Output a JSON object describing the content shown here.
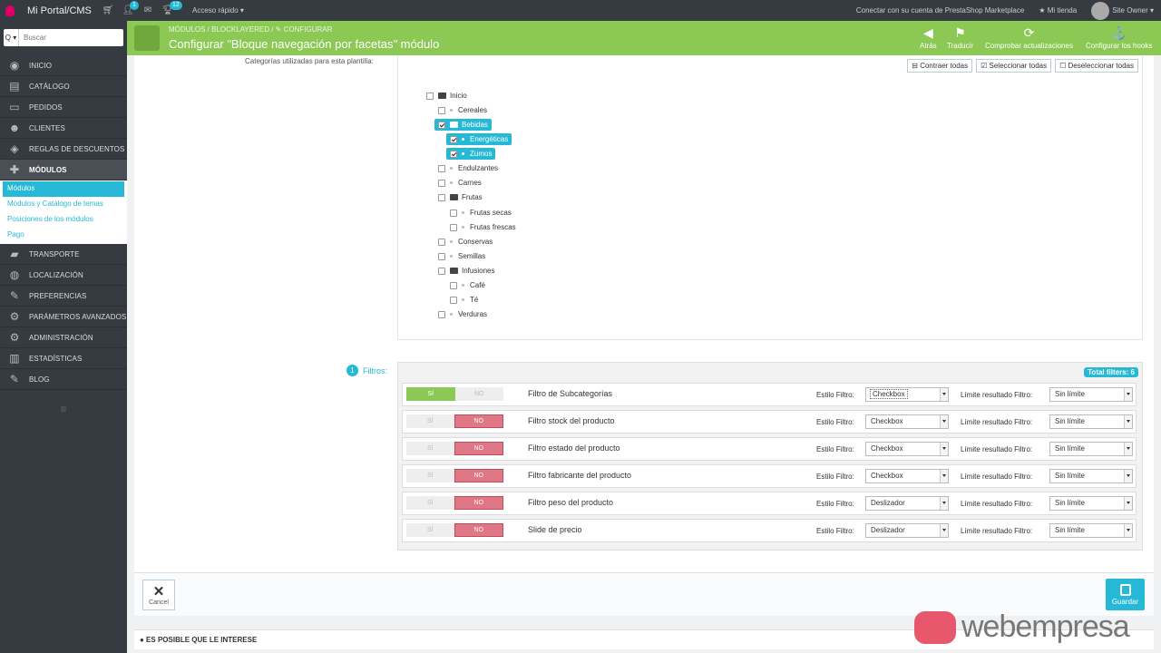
{
  "topbar": {
    "shop_name": "Mi Portal/CMS",
    "badge_customers": "1",
    "badge_orders": "12",
    "quick_access": "Acceso rápido ▾",
    "connect": "Conectar con su cuenta de PrestaShop Marketplace",
    "my_shop": "★ Mi tienda",
    "user": "Site Owner ▾"
  },
  "sidebar": {
    "search_placeholder": "Buscar",
    "search_btn": "Q ▾",
    "items": [
      "INICIO",
      "CATÁLOGO",
      "PEDIDOS",
      "CLIENTES",
      "REGLAS DE DESCUENTOS",
      "MÓDULOS"
    ],
    "sub_items": [
      "Módulos",
      "Módulos y Catálogo de temas",
      "Posiciones de los módulos",
      "Pago"
    ],
    "items_after": [
      "TRANSPORTE",
      "LOCALIZACIÓN",
      "PREFERENCIAS",
      "PARÁMETROS AVANZADOS",
      "ADMINISTRACIÓN",
      "ESTADÍSTICAS",
      "BLOG"
    ],
    "collapse": "≡"
  },
  "header": {
    "breadcrumb": "MÓDULOS  /  BLOCKLAYERED  /  ✎ CONFIGURAR",
    "title": "Configurar \"Bloque navegación por facetas\" módulo",
    "buttons": [
      "Atrás",
      "Traducir",
      "Comprobar actualizaciones",
      "Configurar los hooks"
    ]
  },
  "categories": {
    "label": "Categorías utilizadas para esta plantilla:",
    "collapse_all": "⊟ Contraer todas",
    "select_all": "☑ Seleccionar todas",
    "deselect_all": "☐ Deseleccionar todas",
    "tree": [
      "Inicio",
      "Cereales",
      "Bebidas",
      "Energéticas",
      "Zumos",
      "Endulzantes",
      "Carnes",
      "Frutas",
      "Frutas secas",
      "Frutas frescas",
      "Conservas",
      "Semillas",
      "Infusiones",
      "Café",
      "Té",
      "Verduras"
    ]
  },
  "filters": {
    "label": "Filtros:",
    "count": "1",
    "total": "Total filters: 6",
    "yes": "SÍ",
    "no": "NO",
    "style_label": "Estilo Filtro:",
    "limit_label": "Límite resultado Filtro:",
    "rows": [
      {
        "name": "Filtro de Subcategorías",
        "style": "Checkbox",
        "limit": "Sin límite",
        "on": true
      },
      {
        "name": "Filtro stock del producto",
        "style": "Checkbox",
        "limit": "Sin límite",
        "on": false
      },
      {
        "name": "Filtro estado del producto",
        "style": "Checkbox",
        "limit": "Sin límite",
        "on": false
      },
      {
        "name": "Filtro fabricante del producto",
        "style": "Checkbox",
        "limit": "Sin límite",
        "on": false
      },
      {
        "name": "Filtro peso del producto",
        "style": "Deslizador",
        "limit": "Sin límite",
        "on": false
      },
      {
        "name": "Slide de precio",
        "style": "Deslizador",
        "limit": "Sin límite",
        "on": false
      }
    ]
  },
  "footer": {
    "cancel": "Cancel",
    "save": "Guardar",
    "interest": "● ES POSIBLE QUE LE INTERESE"
  },
  "watermark": "webempresa",
  "colors": {
    "accent": "#25b9d7",
    "header_green": "#8bc954",
    "sidebar": "#363a41",
    "no_red": "#e07786"
  }
}
